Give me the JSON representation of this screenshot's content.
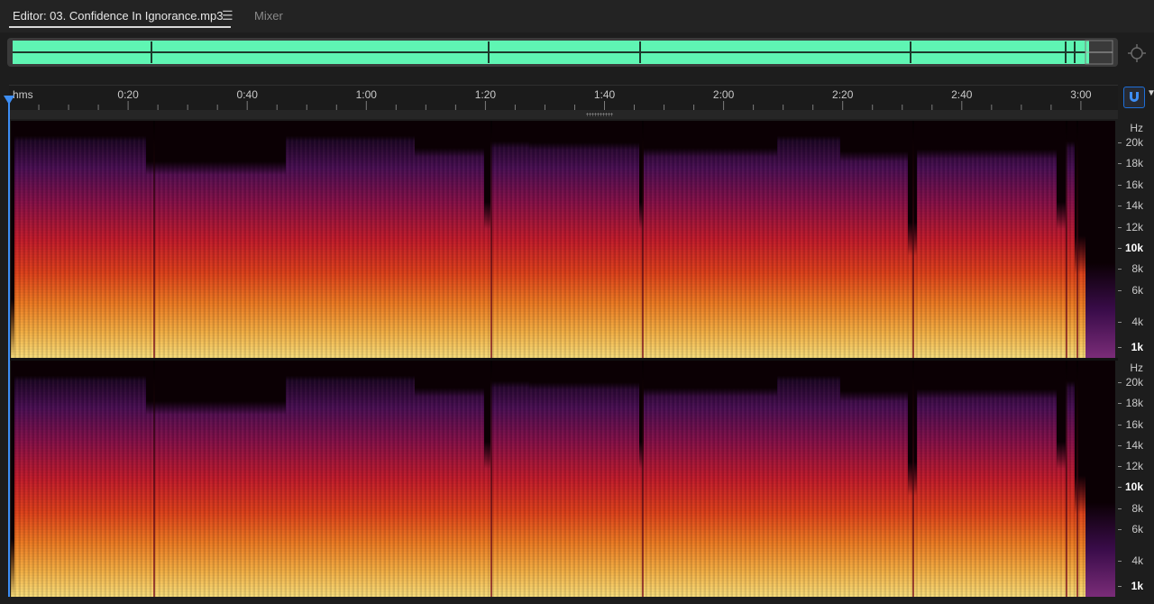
{
  "tabs": {
    "editor_label": "Editor: 03. Confidence In Ignorance.mp3",
    "menu_icon": "hamburger-menu-icon",
    "mixer_label": "Mixer"
  },
  "ruler": {
    "unit_label": "hms",
    "time_labels": [
      "0:20",
      "0:40",
      "1:00",
      "1:20",
      "1:40",
      "2:00",
      "2:20",
      "2:40",
      "3:00"
    ]
  },
  "frequency_axis": {
    "unit": "Hz",
    "labels": [
      "20k",
      "18k",
      "16k",
      "14k",
      "12k",
      "10k",
      "8k",
      "6k",
      "4k",
      "1k"
    ],
    "bold_labels": [
      "10k",
      "1k"
    ]
  },
  "colors": {
    "overview_waveform": "#5ff5b3",
    "playhead": "#3d8ef5",
    "accent": "#1e6fd9"
  },
  "icons": {
    "zoom": "zoom-crosshair-icon",
    "snap": "magnet-snap-icon"
  }
}
